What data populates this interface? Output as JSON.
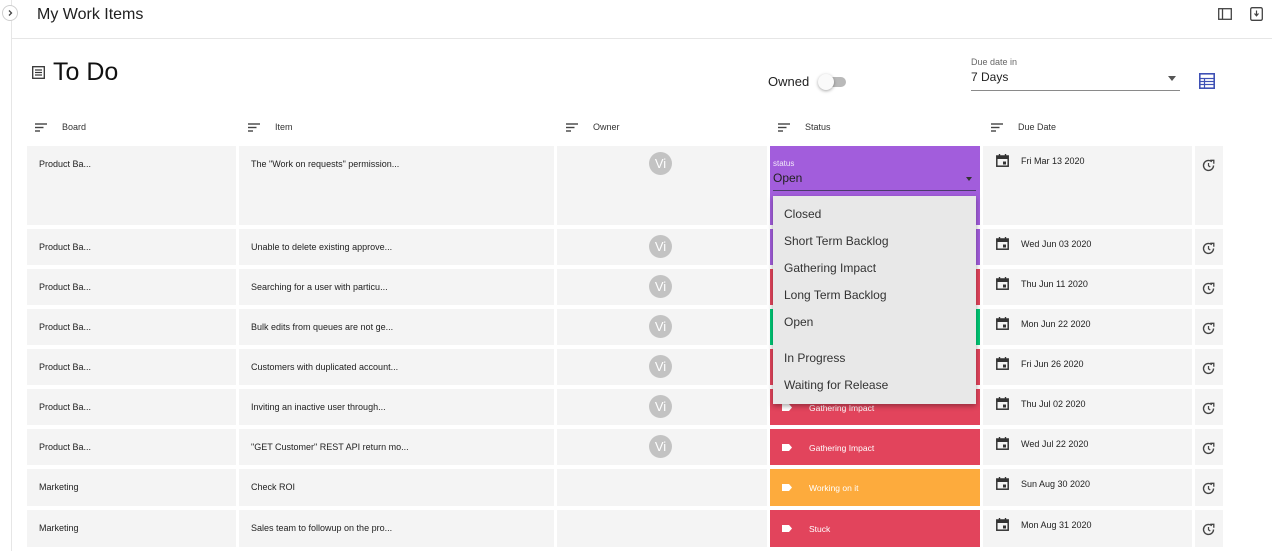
{
  "app": {
    "title": "My Work Items"
  },
  "page": {
    "title": "To Do"
  },
  "filters": {
    "owned_label": "Owned",
    "owned_on": false,
    "due_label": "Due date in",
    "due_value": "7 Days"
  },
  "columns": [
    "Board",
    "Item",
    "Owner",
    "Status",
    "Due Date"
  ],
  "status_editor": {
    "label": "status",
    "value": "Open"
  },
  "status_options": [
    "Closed",
    "Short Term Backlog",
    "Gathering Impact",
    "Long Term Backlog",
    "Open",
    "In Progress",
    "Waiting for Release"
  ],
  "rows": [
    {
      "board": "Product Ba...",
      "item": "The \"Work on requests\" permission...",
      "owner": "Vi",
      "status": "Open",
      "status_color": "#a25ddc",
      "due": "Fri Mar 13 2020"
    },
    {
      "board": "Product Ba...",
      "item": "Unable to delete existing approve...",
      "owner": "Vi",
      "status": "",
      "status_color": "#a25ddc",
      "due": "Wed Jun 03 2020"
    },
    {
      "board": "Product Ba...",
      "item": "Searching for a user with particu...",
      "owner": "Vi",
      "status": "",
      "status_color": "#e2445c",
      "due": "Thu Jun 11 2020"
    },
    {
      "board": "Product Ba...",
      "item": "Bulk edits from queues are not ge...",
      "owner": "Vi",
      "status": "",
      "status_color": "#00c875",
      "due": "Mon Jun 22 2020"
    },
    {
      "board": "Product Ba...",
      "item": "Customers with duplicated account...",
      "owner": "Vi",
      "status": "",
      "status_color": "#e2445c",
      "due": "Fri Jun 26 2020"
    },
    {
      "board": "Product Ba...",
      "item": "Inviting an inactive user through...",
      "owner": "Vi",
      "status": "Gathering Impact",
      "status_color": "#e2445c",
      "due": "Thu Jul 02 2020"
    },
    {
      "board": "Product Ba...",
      "item": "\"GET Customer\" REST API return mo...",
      "owner": "Vi",
      "status": "Gathering Impact",
      "status_color": "#e2445c",
      "due": "Wed Jul 22 2020"
    },
    {
      "board": "Marketing",
      "item": "Check ROI",
      "owner": "",
      "status": "Working on it",
      "status_color": "#fdab3d",
      "due": "Sun Aug 30 2020"
    },
    {
      "board": "Marketing",
      "item": "Sales team to followup on the pro...",
      "owner": "",
      "status": "Stuck",
      "status_color": "#e2445c",
      "due": "Mon Aug 31 2020"
    }
  ],
  "icons": {
    "expand": "chevron-right-icon",
    "panel": "sidebar-panel-icon",
    "exit": "exit-icon",
    "page": "table-icon",
    "view": "table-view-icon",
    "sort": "sort-icon",
    "tag": "tag-icon",
    "calendar": "calendar-icon",
    "refresh": "refresh-icon"
  },
  "colors": {
    "accent": "#3f51b5"
  }
}
